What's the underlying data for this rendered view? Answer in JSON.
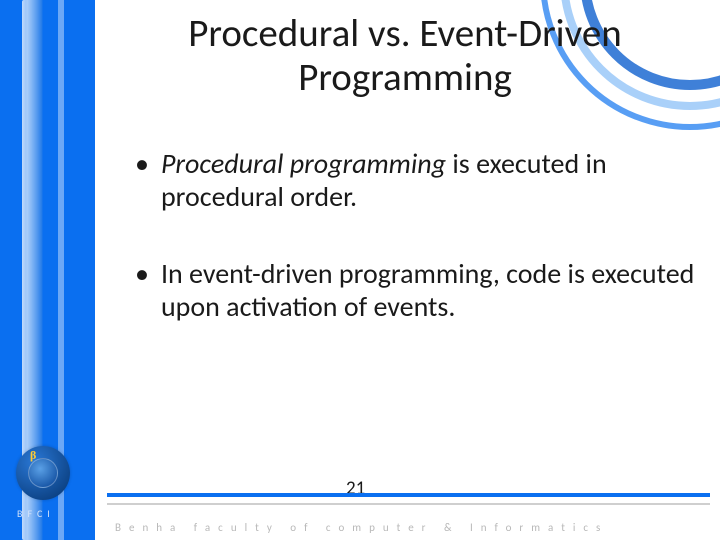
{
  "title": "Procedural vs. Event-Driven Programming",
  "bullets": [
    {
      "italic_lead": "Procedural programming",
      "rest": " is executed in procedural order."
    },
    {
      "italic_lead": "",
      "rest": "In event-driven programming, code is executed upon activation of events."
    }
  ],
  "page_number": "21",
  "footer_text": "Benha faculty of computer & Informatics",
  "logo_label": "BFCI"
}
